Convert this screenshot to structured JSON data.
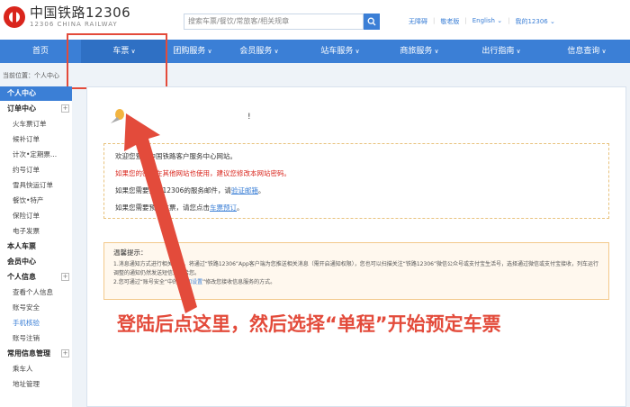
{
  "header": {
    "logo_title": "中国铁路12306",
    "logo_sub": "12306 CHINA RAILWAY",
    "search_placeholder": "搜索车票/餐饮/常旅客/相关规章",
    "top_links": [
      "无障碍",
      "敬老版",
      "English",
      "我的12306"
    ]
  },
  "nav": {
    "items": [
      {
        "label": "首页",
        "has_menu": false
      },
      {
        "label": "车票",
        "has_menu": true
      },
      {
        "label": "团购服务",
        "has_menu": true
      },
      {
        "label": "会员服务",
        "has_menu": true
      },
      {
        "label": "站车服务",
        "has_menu": true
      },
      {
        "label": "商旅服务",
        "has_menu": true
      },
      {
        "label": "出行指南",
        "has_menu": true
      },
      {
        "label": "信息查询",
        "has_menu": true
      }
    ]
  },
  "breadcrumb": "当前位置：个人中心",
  "sidebar": {
    "header": "个人中心",
    "groups": [
      {
        "label": "订单中心",
        "expandable": true,
        "items": [
          "火车票订单",
          "候补订单",
          "计次•定期票...",
          "约号订单",
          "雪具快运订单",
          "餐饮•特产",
          "保险订单",
          "电子发票"
        ]
      },
      {
        "label": "本人车票",
        "expandable": false,
        "items": []
      },
      {
        "label": "会员中心",
        "expandable": false,
        "items": []
      },
      {
        "label": "个人信息",
        "expandable": true,
        "items": [
          "查看个人信息",
          "账号安全",
          "手机核验",
          "账号注销"
        ]
      },
      {
        "label": "常用信息管理",
        "expandable": true,
        "items": [
          "乘车人",
          "地址管理"
        ]
      }
    ],
    "active_item": "手机核验"
  },
  "main": {
    "greeting": "!",
    "welcome": {
      "line1": "欢迎您登录中国铁路客户服务中心网站。",
      "line2": "如果您的密码在其他网站也使用，建议您修改本网站密码。",
      "line3_pre": "如果您需要接收12306的服务邮件，请",
      "line3_link": "验证邮箱",
      "line3_post": "。",
      "line4_pre": "如果您需要预订车票，请您点击",
      "line4_link": "车票预订",
      "line4_post": "。"
    },
    "tips": {
      "title": "温馨提示：",
      "line1": "1.消息通知方式进行相关调整，将通过“铁路12306”App客户端为您推送相关消息（需开启通知权限），您也可以扫描关注“铁路12306”微信公众号或支付宝生活号，选择通过微信或支付宝接收，列车运行调整的通知仍然发送短信通知给您。",
      "line2_pre": "2.您可通过“账号安全”中的“",
      "line2_link": "通知设置",
      "line2_post": "”修改您接收信息服务的方式。"
    }
  },
  "annotation": {
    "text": "登陆后点这里，然后选择“单程”开始预定车票",
    "color": "#e34b3b"
  },
  "colors": {
    "brand_blue": "#3b7fd6",
    "brand_red": "#d9251c"
  }
}
